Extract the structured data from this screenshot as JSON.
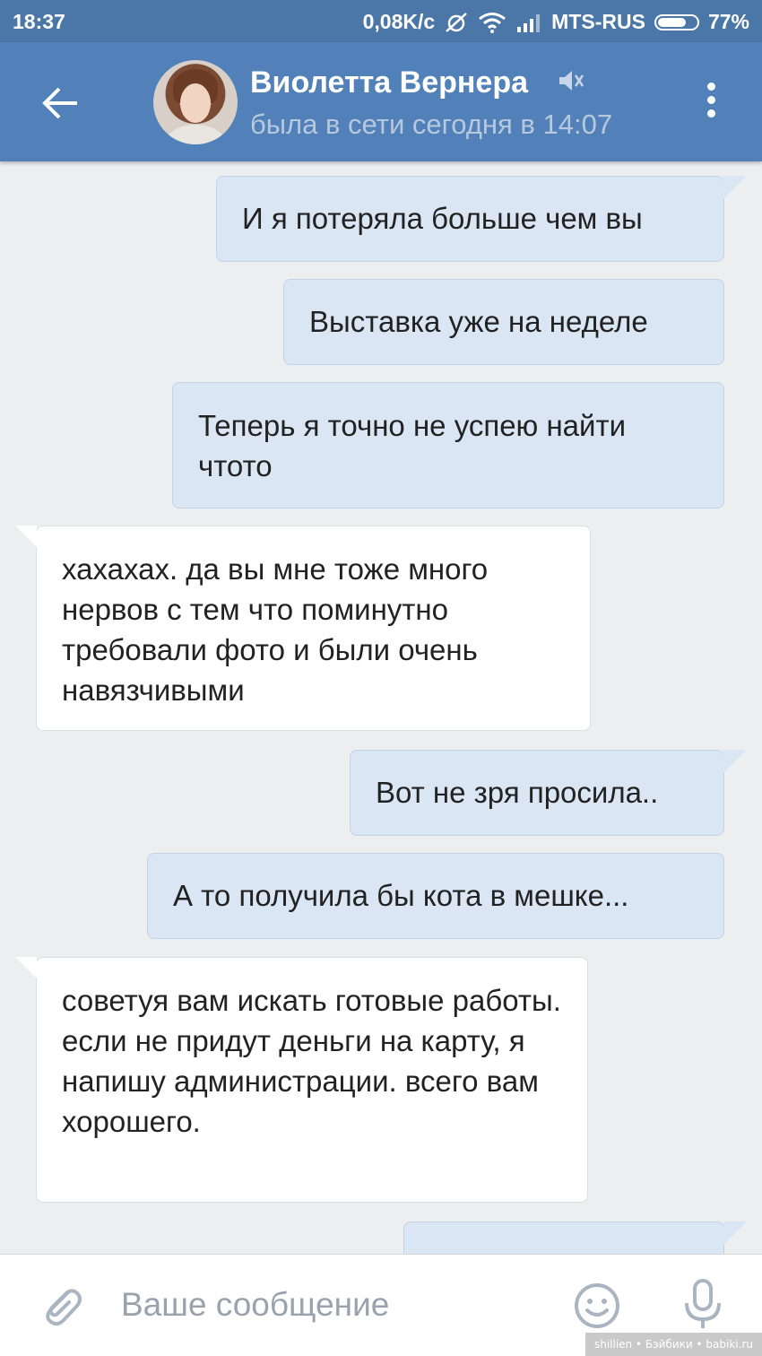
{
  "status_bar": {
    "time": "18:37",
    "speed": "0,08K/c",
    "carrier": "MTS-RUS",
    "battery_percent": "77%",
    "battery_level": 0.77
  },
  "header": {
    "contact_name": "Виолетта Вернера",
    "contact_status": "была в сети сегодня в 14:07",
    "back_icon": "arrow-left-icon",
    "mute_icon": "mute-icon",
    "menu_icon": "more-vertical-icon"
  },
  "messages": [
    {
      "direction": "out",
      "text": "И я потеряла больше чем вы"
    },
    {
      "direction": "out",
      "text": "Выставка уже на неделе"
    },
    {
      "direction": "out",
      "text": "Теперь я точно не успею найти чтото"
    },
    {
      "direction": "in",
      "text": "хахахах. да вы мне тоже много нервов с тем что поминутно требовали фото и были очень навязчивыми"
    },
    {
      "direction": "out",
      "text": "Вот не зря просила.."
    },
    {
      "direction": "out",
      "text": "А то получила бы кота в мешке..."
    },
    {
      "direction": "in",
      "text": "советуя вам искать готовые работы. если не придут деньги на карту, я напишу администрации. всего вам хорошего."
    },
    {
      "direction": "out",
      "text": ""
    }
  ],
  "composer": {
    "placeholder": "Ваше сообщение",
    "attach_icon": "paperclip-icon",
    "emoji_icon": "smile-icon",
    "voice_icon": "microphone-icon"
  },
  "watermark": "shillien • Бэйбики • babiki.ru",
  "colors": {
    "header_bg": "#5181b8",
    "status_bar_bg": "#4a76a8",
    "chat_bg": "#edeef0",
    "outgoing_bubble": "#dae6f4",
    "incoming_bubble": "#ffffff"
  }
}
